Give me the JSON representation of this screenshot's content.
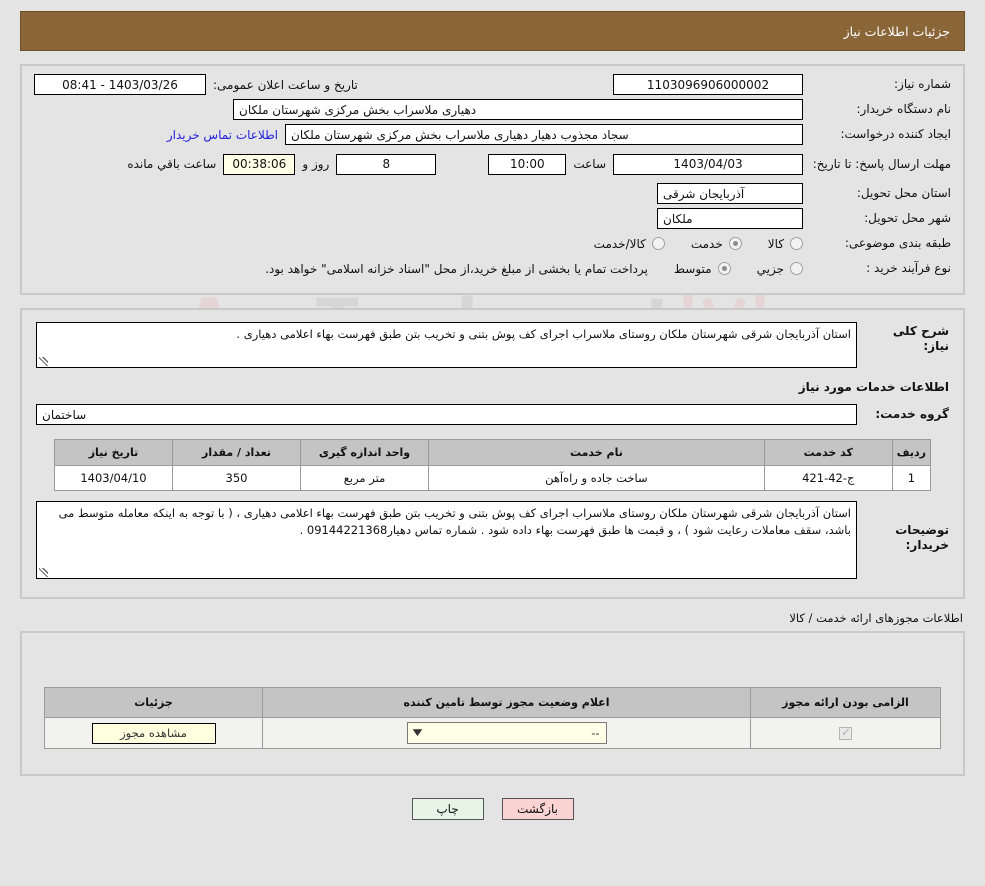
{
  "header": {
    "title": "جزئیات اطلاعات نیاز"
  },
  "watermark": {
    "text_left": "Ana",
    "text_right": "Tender.net"
  },
  "summary": {
    "need_number_label": "شماره نیاز:",
    "need_number_value": "1103096906000002",
    "announce_datetime_label": "تاریخ و ساعت اعلان عمومی:",
    "announce_datetime_value": "1403/03/26 - 08:41",
    "buyer_org_label": "نام دستگاه خریدار:",
    "buyer_org_value": "دهیاری ملاسراب بخش مرکزی شهرستان ملکان",
    "requester_label": "ایجاد کننده درخواست:",
    "requester_value": "سجاد مجذوب دهیار دهیاری ملاسراب بخش مرکزی شهرستان ملکان",
    "contact_link": "اطلاعات تماس خریدار",
    "deadline_label": "مهلت ارسال پاسخ: تا تاریخ:",
    "deadline_date": "1403/04/03",
    "hour_label": "ساعت",
    "deadline_time": "10:00",
    "days_value": "8",
    "days_label": "روز و",
    "countdown_value": "00:38:06",
    "remaining_label": "ساعت باقي مانده",
    "province_label": "استان محل تحویل:",
    "province_value": "آذربایجان شرقی",
    "city_label": "شهر محل تحویل:",
    "city_value": "ملکان",
    "category_label": "طبقه بندی موضوعی:",
    "category_options": [
      {
        "label": "کالا",
        "selected": false
      },
      {
        "label": "خدمت",
        "selected": true
      },
      {
        "label": "کالا/خدمت",
        "selected": false
      }
    ],
    "process_label": "نوع فرآیند خرید :",
    "process_options": [
      {
        "label": "جزیي",
        "selected": false
      },
      {
        "label": "متوسط",
        "selected": true
      }
    ],
    "process_note": "پرداخت تمام یا بخشی از مبلغ خرید،از محل \"اسناد خزانه اسلامی\" خواهد بود."
  },
  "description": {
    "general_label": "شرح کلی نیاز:",
    "general_value": "استان آذربایجان شرقی شهرستان ملکان روستای ملاسراب اجرای کف پوش بتنی و تخریب بتن طبق فهرست بهاء اعلامی دهیاری .",
    "services_head": "اطلاعات خدمات مورد نیاز",
    "service_group_label": "گروه خدمت:",
    "service_group_value": "ساختمان"
  },
  "items_table": {
    "columns": [
      "ردیف",
      "کد خدمت",
      "نام خدمت",
      "واحد اندازه گیری",
      "تعداد / مقدار",
      "تاریخ نیاز"
    ],
    "rows": [
      {
        "row": "1",
        "code": "ج-42-421",
        "name": "ساخت جاده و راه‌آهن",
        "unit": "متر مربع",
        "qty": "350",
        "date": "1403/04/10"
      }
    ]
  },
  "buyer_notes": {
    "label": "توضیحات خریدار:",
    "value": "استان آذربایجان شرقی شهرستان ملکان روستای ملاسراب اجرای کف پوش بتنی و تخریب بتن طبق فهرست بهاء اعلامی دهیاری ، ( با توجه به اینکه معامله متوسط می باشد، سقف معاملات رعایت شود ) ، و قیمت ها طبق فهرست بهاء داده شود . شماره تماس دهیار09144221368 ."
  },
  "licenses": {
    "section_label": "اطلاعات مجوزهای ارائه خدمت / کالا",
    "columns": [
      "الزامی بودن ارائه مجوز",
      "اعلام وضعیت مجوز توسط تامین کننده",
      "جزئیات"
    ],
    "rows": [
      {
        "required_checked": true,
        "status_value": "--",
        "details_button": "مشاهده مجوز"
      }
    ]
  },
  "footer": {
    "print_label": "چاپ",
    "back_label": "بازگشت"
  },
  "colors": {
    "header_bg": "#8a6537",
    "page_bg": "#e4e4e4",
    "link": "#2222dd",
    "print_btn": "#e6f5e6",
    "back_btn": "#fbd3d3",
    "table_header": "#c4c4c4"
  }
}
